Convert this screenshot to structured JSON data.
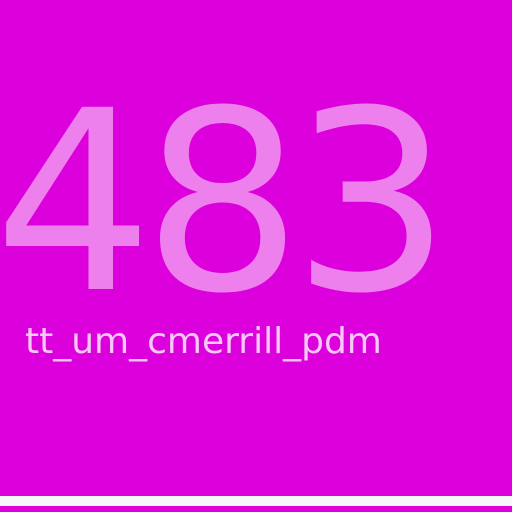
{
  "tile": {
    "number": "483",
    "label": "tt_um_cmerrill_pdm"
  },
  "colors": {
    "background": "#dc00dc",
    "number": "#ee80ee",
    "label": "#f6c8f6",
    "strip": "#f7f7f7"
  }
}
